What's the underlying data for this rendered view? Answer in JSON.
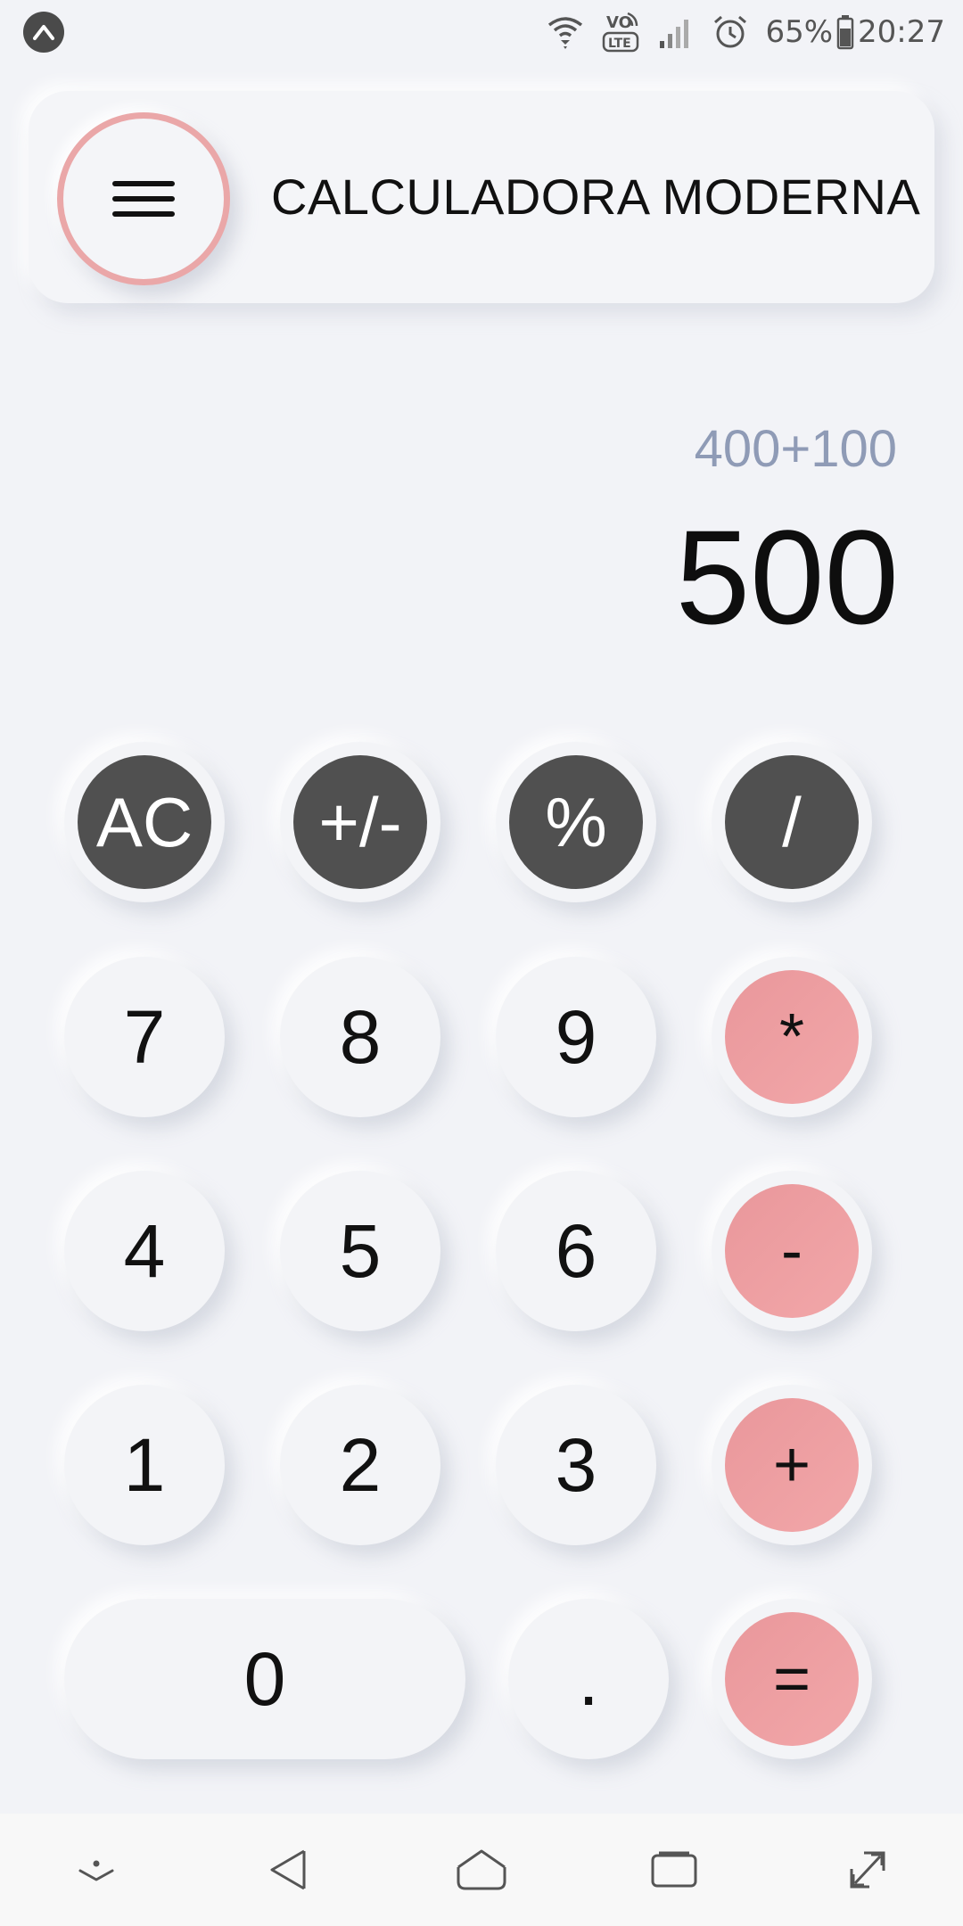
{
  "status_bar": {
    "app_icon": "caret-up-icon",
    "battery_percent": "65%",
    "time": "20:27",
    "icons": [
      "wifi-icon",
      "volte-icon",
      "signal-icon",
      "alarm-icon",
      "battery-icon"
    ]
  },
  "header": {
    "menu_icon": "hamburger-menu-icon",
    "title": "CALCULADORA MODERNA",
    "accent_color": "#eaa7a8"
  },
  "display": {
    "expression": "400+100",
    "result": "500"
  },
  "keypad": {
    "rows": [
      [
        {
          "label": "AC",
          "style": "dark"
        },
        {
          "label": "+/-",
          "style": "dark"
        },
        {
          "label": "%",
          "style": "dark"
        },
        {
          "label": "/",
          "style": "dark"
        }
      ],
      [
        {
          "label": "7",
          "style": "light"
        },
        {
          "label": "8",
          "style": "light"
        },
        {
          "label": "9",
          "style": "light"
        },
        {
          "label": "*",
          "style": "pink"
        }
      ],
      [
        {
          "label": "4",
          "style": "light"
        },
        {
          "label": "5",
          "style": "light"
        },
        {
          "label": "6",
          "style": "light"
        },
        {
          "label": "-",
          "style": "pink"
        }
      ],
      [
        {
          "label": "1",
          "style": "light"
        },
        {
          "label": "2",
          "style": "light"
        },
        {
          "label": "3",
          "style": "light"
        },
        {
          "label": "+",
          "style": "pink"
        }
      ],
      [
        {
          "label": "0",
          "style": "light"
        },
        {
          "label": ".",
          "style": "light"
        },
        {
          "label": "=",
          "style": "pink"
        }
      ]
    ],
    "colors": {
      "dark": "#505050",
      "pink": "#f0a3a6",
      "light": "#f3f4f7"
    }
  },
  "nav_bar": {
    "icons": [
      "notification-pull-icon",
      "back-icon",
      "home-icon",
      "recents-icon",
      "screen-expand-icon"
    ]
  }
}
